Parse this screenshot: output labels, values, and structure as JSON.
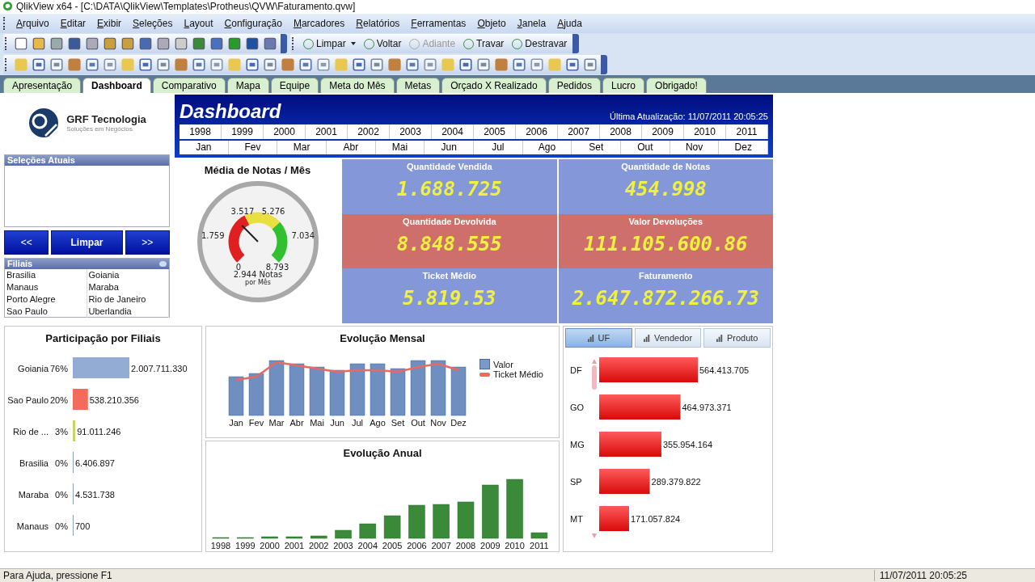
{
  "window": {
    "title": "QlikView x64 - [C:\\DATA\\QlikView\\Templates\\Protheus\\QVW\\Faturamento.qvw]"
  },
  "menu": [
    "Arquivo",
    "Editar",
    "Exibir",
    "Seleções",
    "Layout",
    "Configuração",
    "Marcadores",
    "Relatórios",
    "Ferramentas",
    "Objeto",
    "Janela",
    "Ajuda"
  ],
  "toolbar": {
    "buttons": [
      {
        "label": "Limpar",
        "kind": "dropdown",
        "disabled": false
      },
      {
        "label": "Voltar",
        "kind": "plain",
        "disabled": false
      },
      {
        "label": "Adiante",
        "kind": "plain",
        "disabled": true
      },
      {
        "label": "Travar",
        "kind": "plain",
        "disabled": false
      },
      {
        "label": "Destravar",
        "kind": "plain",
        "disabled": false
      }
    ]
  },
  "sheet_tabs": [
    {
      "label": "Apresentação",
      "selected": false
    },
    {
      "label": "Dashboard",
      "selected": true
    },
    {
      "label": "Comparativo",
      "selected": false
    },
    {
      "label": "Mapa",
      "selected": false
    },
    {
      "label": "Equipe",
      "selected": false
    },
    {
      "label": "Meta do Mês",
      "selected": false
    },
    {
      "label": "Metas",
      "selected": false
    },
    {
      "label": "Orçado X Realizado",
      "selected": false
    },
    {
      "label": "Pedidos",
      "selected": false
    },
    {
      "label": "Lucro",
      "selected": false
    },
    {
      "label": "Obrigado!",
      "selected": false
    }
  ],
  "logo": {
    "name": "GRF Tecnologia",
    "tagline": "Soluções em Negócios"
  },
  "current_selections": {
    "title": "Seleções Atuais"
  },
  "nav_buttons": [
    "<<",
    "Limpar",
    ">>"
  ],
  "filiais": {
    "title": "Filiais",
    "items": [
      "Brasilia",
      "Goiania",
      "Manaus",
      "Maraba",
      "Porto Alegre",
      "Rio de Janeiro",
      "Sao Paulo",
      "Uberlandia"
    ]
  },
  "header": {
    "title": "Dashboard",
    "updated": "Última Atualização: 11/07/2011 20:05:25",
    "years": [
      {
        "label": "1998",
        "selected": false
      },
      {
        "label": "1999",
        "selected": false
      },
      {
        "label": "2000",
        "selected": false
      },
      {
        "label": "2001",
        "selected": false
      },
      {
        "label": "2002",
        "selected": false
      },
      {
        "label": "2003",
        "selected": false
      },
      {
        "label": "2004",
        "selected": false
      },
      {
        "label": "2005",
        "selected": false
      },
      {
        "label": "2006",
        "selected": false
      },
      {
        "label": "2007",
        "selected": false
      },
      {
        "label": "2008",
        "selected": false
      },
      {
        "label": "2009",
        "selected": false
      },
      {
        "label": "2010",
        "selected": false
      },
      {
        "label": "2011",
        "selected": false
      }
    ],
    "months": [
      {
        "label": "Jan",
        "selected": false
      },
      {
        "label": "Fev",
        "selected": false
      },
      {
        "label": "Mar",
        "selected": false
      },
      {
        "label": "Abr",
        "selected": false
      },
      {
        "label": "Mai",
        "selected": false
      },
      {
        "label": "Jun",
        "selected": false
      },
      {
        "label": "Jul",
        "selected": false
      },
      {
        "label": "Ago",
        "selected": false
      },
      {
        "label": "Set",
        "selected": false
      },
      {
        "label": "Out",
        "selected": false
      },
      {
        "label": "Nov",
        "selected": false
      },
      {
        "label": "Dez",
        "selected": false
      }
    ]
  },
  "gauge": {
    "title": "Média de Notas / Mês",
    "ticks": [
      "3.517",
      "5.276",
      "1.759",
      "7.034",
      "0",
      "8.793"
    ],
    "reading": "2.944 Notas",
    "unit": "por Mês"
  },
  "kpis": [
    {
      "label": "Quantidade Vendida",
      "value": "1.688.725",
      "color": "#8497d8"
    },
    {
      "label": "Quantidade de Notas",
      "value": "454.998",
      "color": "#8497d8"
    },
    {
      "label": "Quantidade Devolvida",
      "value": "8.848.555",
      "color": "#cf6f6c"
    },
    {
      "label": "Valor Devoluções",
      "value": "111.105.600.86",
      "color": "#cf6f6c"
    },
    {
      "label": "Ticket Médio",
      "value": "5.819.53",
      "color": "#8497d8"
    },
    {
      "label": "Faturamento",
      "value": "2.647.872.266.73",
      "color": "#8497d8"
    }
  ],
  "participation": {
    "title": "Participação por Filiais",
    "percents": [
      "76%",
      "20%",
      "3%",
      "0%",
      "0%",
      "0%"
    ],
    "chart_data": {
      "type": "bar",
      "orientation": "horizontal",
      "categories": [
        "Goiania",
        "Sao Paulo",
        "Rio de ...",
        "Brasilia",
        "Maraba",
        "Manaus"
      ],
      "values": [
        2007711330,
        538210356,
        91011246,
        6406897,
        4531738,
        700
      ],
      "value_labels": [
        "2.007.711.330",
        "538.210.356",
        "91.011.246",
        "6.406.897",
        "4.531.738",
        "700"
      ]
    }
  },
  "monthly": {
    "title": "Evolução Mensal",
    "months": [
      "Jan",
      "Fev",
      "Mar",
      "Abr",
      "Mai",
      "Jun",
      "Jul",
      "Ago",
      "Set",
      "Out",
      "Nov",
      "Dez"
    ],
    "legend": [
      {
        "label": "Valor",
        "kind": "bar"
      },
      {
        "label": "Ticket Médio",
        "kind": "line"
      }
    ]
  },
  "annual": {
    "title": "Evolução Anual",
    "years": [
      "1998",
      "1999",
      "2000",
      "2001",
      "2002",
      "2003",
      "2004",
      "2005",
      "2006",
      "2007",
      "2008",
      "2009",
      "2010",
      "2011"
    ]
  },
  "ranking": {
    "tabs": [
      {
        "label": "UF",
        "selected": true
      },
      {
        "label": "Vendedor",
        "selected": false
      },
      {
        "label": "Produto",
        "selected": false
      }
    ],
    "chart_data": {
      "type": "bar",
      "orientation": "horizontal",
      "categories": [
        "DF",
        "GO",
        "MG",
        "SP",
        "MT"
      ],
      "values": [
        564413705,
        464973371,
        355954164,
        289379822,
        171057824
      ],
      "value_labels": [
        "564.413.705",
        "464.973.371",
        "355.954.164",
        "289.379.822",
        "171.057.824"
      ]
    }
  },
  "status_bar": {
    "help": "Para Ajuda, pressione F1",
    "time": "11/07/2011 20:05:25"
  }
}
